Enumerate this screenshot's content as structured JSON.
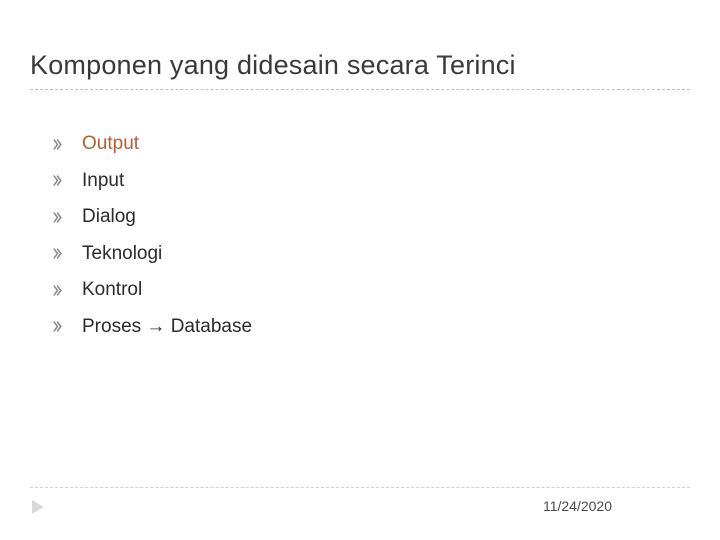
{
  "slide": {
    "title": "Komponen yang didesain secara Terinci",
    "bullets": [
      "Output",
      "Input",
      "Dialog",
      "Teknologi",
      "Kontrol",
      "Proses → Database"
    ],
    "date": "11/24/2020",
    "colors": {
      "accent": "#b85c3a",
      "bullet": "#777777",
      "text": "#2b2b2b",
      "rule": "#cfcfcf"
    }
  }
}
